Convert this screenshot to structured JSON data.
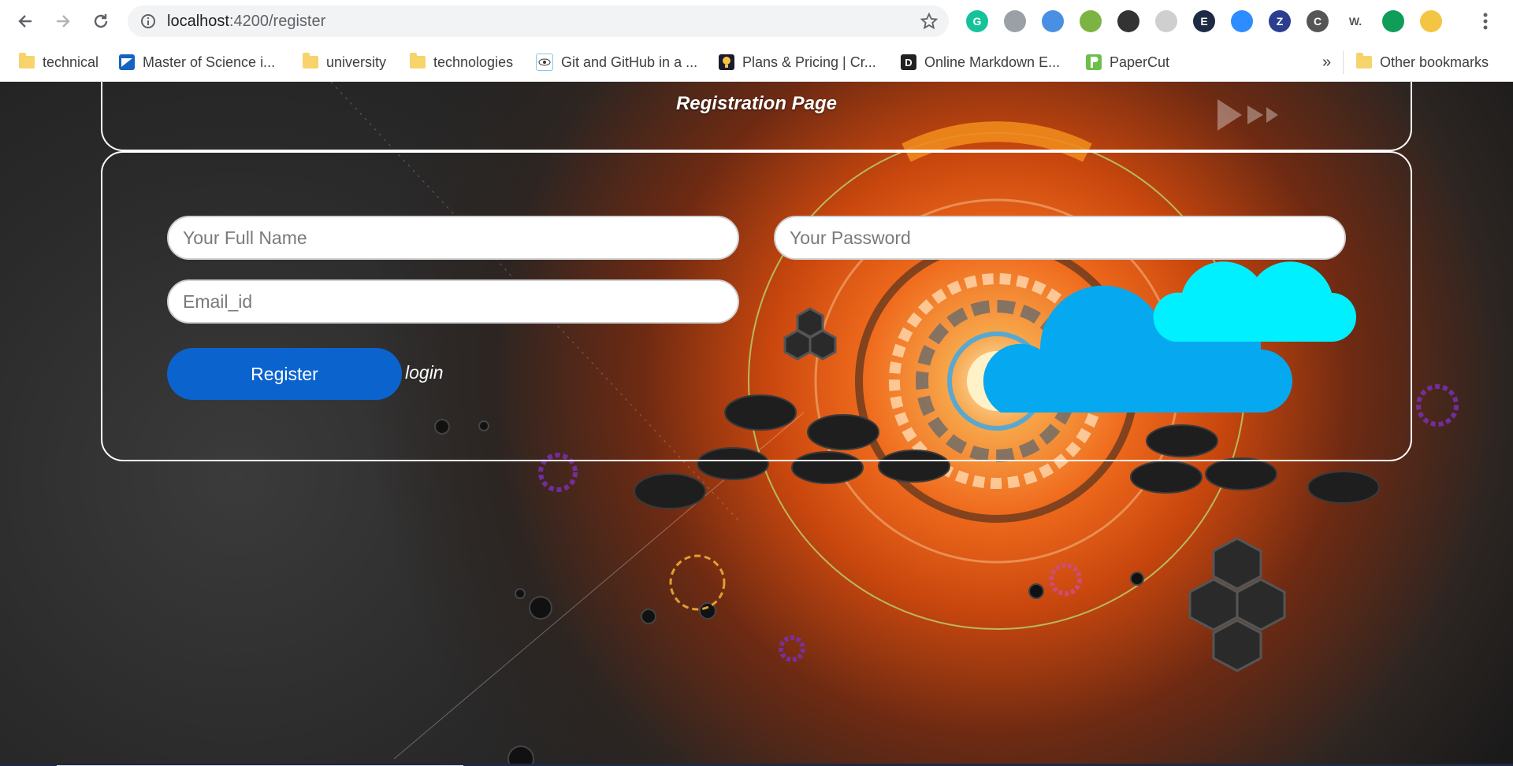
{
  "browser": {
    "url_host": "localhost",
    "url_path": ":4200/register",
    "nav": {
      "back": "back-arrow-icon",
      "forward": "forward-arrow-icon",
      "reload": "reload-icon"
    },
    "extensions": [
      {
        "name": "grammarly-icon",
        "color": "#15c39a",
        "glyph": "G"
      },
      {
        "name": "extension-circle-icon",
        "color": "#9aa0a6",
        "glyph": ""
      },
      {
        "name": "translate-icon",
        "color": "#4a90e2",
        "glyph": ""
      },
      {
        "name": "money-icon",
        "color": "#7cb342",
        "glyph": ""
      },
      {
        "name": "openai-icon",
        "color": "#333333",
        "glyph": ""
      },
      {
        "name": "extension-gray-icon",
        "color": "#cfcfcf",
        "glyph": ""
      },
      {
        "name": "e-extension-icon",
        "color": "#1e2a44",
        "glyph": "E"
      },
      {
        "name": "zoom-icon",
        "color": "#2d8cff",
        "glyph": ""
      },
      {
        "name": "zotero-icon",
        "color": "#2c3e8f",
        "glyph": "Z"
      },
      {
        "name": "code-icon",
        "color": "#555555",
        "glyph": "C"
      },
      {
        "name": "w-extension-icon",
        "color": "#555555",
        "glyph": "W."
      },
      {
        "name": "chat-bubble-icon",
        "color": "#0f9d58",
        "glyph": ""
      },
      {
        "name": "profile-avatar-icon",
        "color": "#f4c542",
        "glyph": ""
      }
    ],
    "bookmarks": [
      {
        "label": "technical",
        "icon": "folder-icon"
      },
      {
        "label": "Master of Science i...",
        "icon": "site-icon",
        "color": "#1565c0"
      },
      {
        "label": "university",
        "icon": "folder-icon"
      },
      {
        "label": "technologies",
        "icon": "folder-icon"
      },
      {
        "label": "Git and GitHub in a ...",
        "icon": "site-icon",
        "color": "#8bc3e6"
      },
      {
        "label": "Plans & Pricing | Cr...",
        "icon": "site-icon",
        "color": "#1b1b2f"
      },
      {
        "label": "Online Markdown E...",
        "icon": "site-icon",
        "color": "#222222",
        "glyph": "D"
      },
      {
        "label": "PaperCut",
        "icon": "site-icon",
        "color": "#6cc04a"
      }
    ],
    "overflow": "»",
    "other_bookmarks": "Other bookmarks"
  },
  "page": {
    "title": "Registration Page",
    "form": {
      "full_name_placeholder": "Your Full Name",
      "password_placeholder": "Your Password",
      "email_placeholder": "Email_id",
      "register_label": "Register",
      "login_label": "login"
    },
    "colors": {
      "register_button": "#0b63ce",
      "panel_border": "#ffffff",
      "accent_orange": "#ef6a1c"
    }
  }
}
